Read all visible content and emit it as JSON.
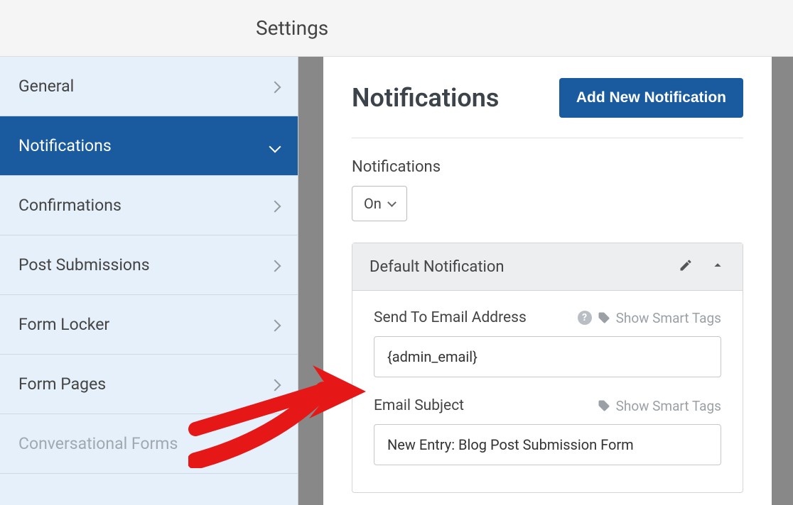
{
  "top_bar": {
    "title": "Settings"
  },
  "sidebar": {
    "items": [
      {
        "label": "General"
      },
      {
        "label": "Notifications"
      },
      {
        "label": "Confirmations"
      },
      {
        "label": "Post Submissions"
      },
      {
        "label": "Form Locker"
      },
      {
        "label": "Form Pages"
      },
      {
        "label": "Conversational Forms"
      }
    ]
  },
  "page": {
    "title": "Notifications",
    "add_button": "Add New Notification",
    "toggle_label": "Notifications",
    "toggle_value": "On"
  },
  "notification": {
    "title": "Default Notification",
    "send_to": {
      "label": "Send To Email Address",
      "smart_tags": "Show Smart Tags",
      "value": "{admin_email}"
    },
    "subject": {
      "label": "Email Subject",
      "smart_tags": "Show Smart Tags",
      "value": "New Entry: Blog Post Submission Form"
    }
  }
}
